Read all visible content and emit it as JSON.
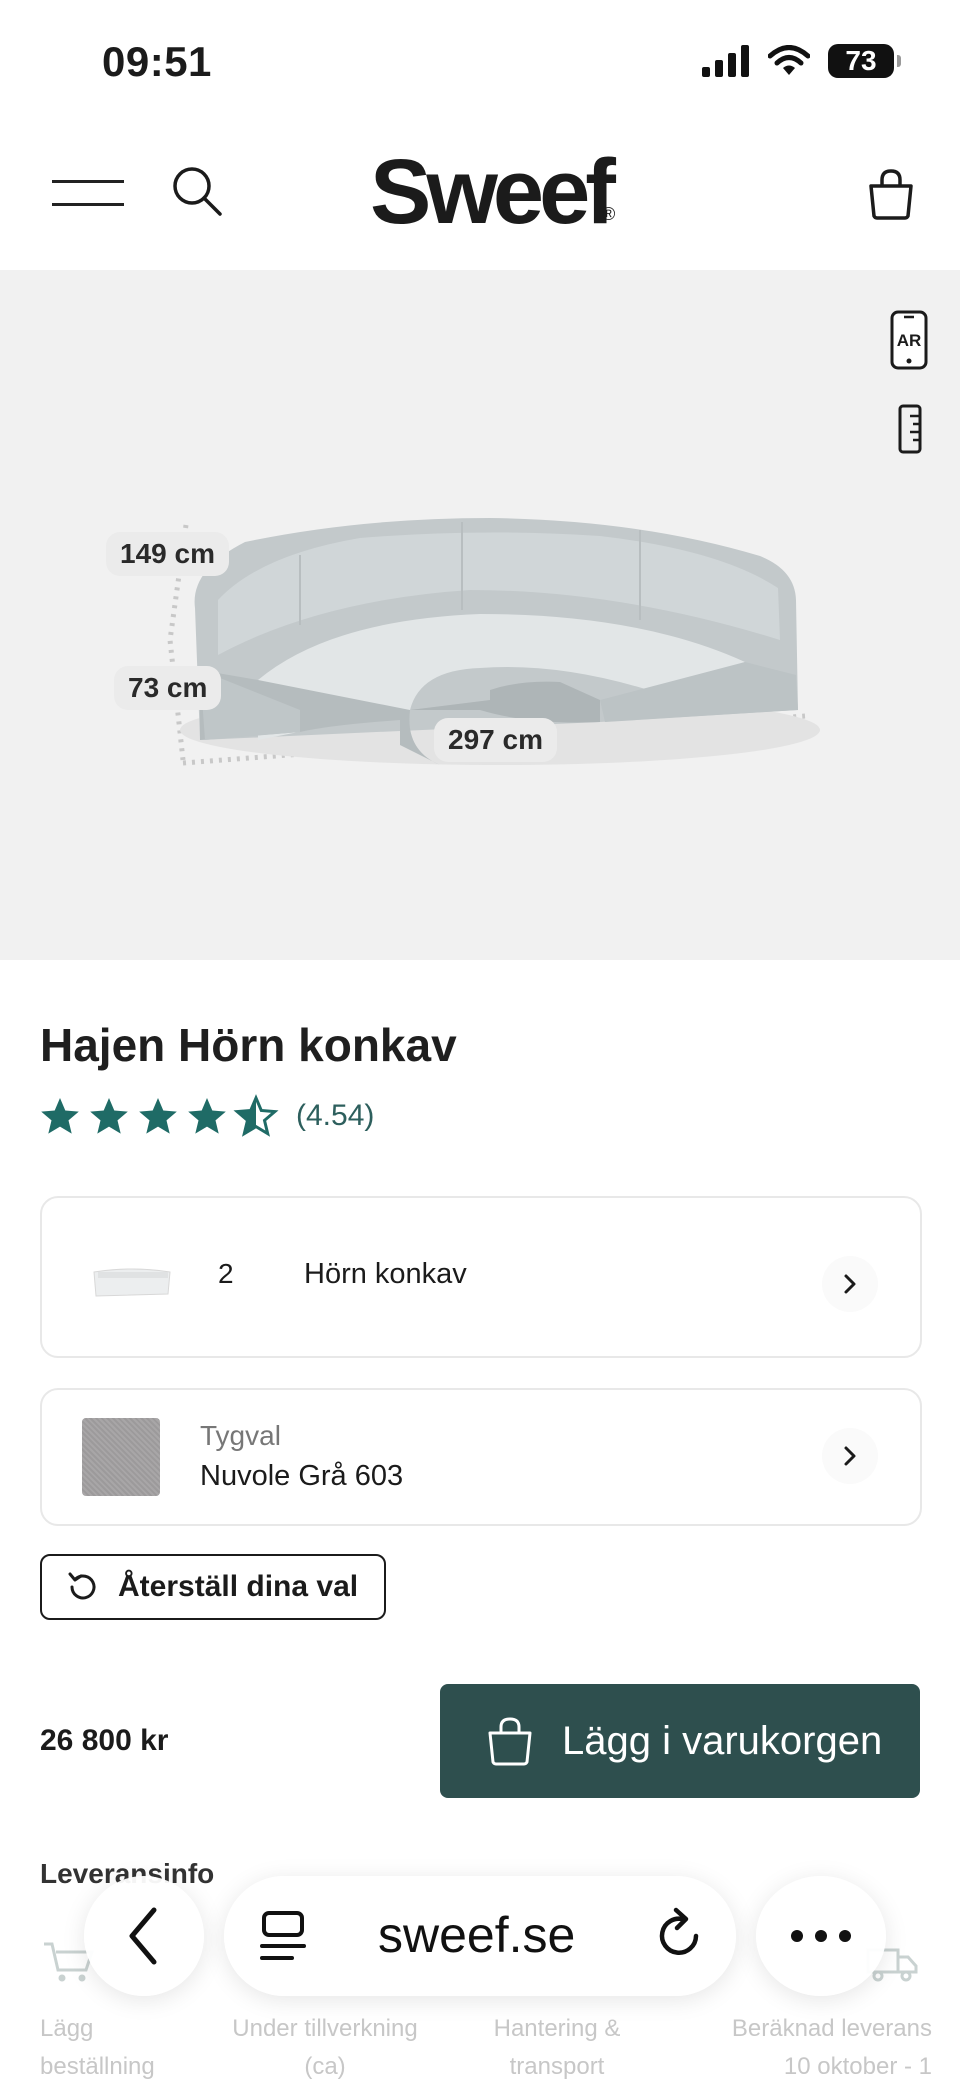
{
  "status_bar": {
    "time": "09:51",
    "battery": "73"
  },
  "header": {
    "logo": "Sweef",
    "logo_mark": "®"
  },
  "stage": {
    "ar_label": "AR",
    "dimensions": {
      "depth": "149 cm",
      "height": "73 cm",
      "width": "297 cm"
    }
  },
  "product": {
    "title": "Hajen Hörn konkav",
    "rating": {
      "stars": 4.5,
      "value_text": "(4.54)"
    },
    "module": {
      "quantity": "2",
      "name": "Hörn konkav"
    },
    "fabric": {
      "label": "Tygval",
      "value": "Nuvole Grå 603"
    },
    "reset_label": "Återställ dina val",
    "price": "26 800 kr",
    "add_to_cart_label": "Lägg i varukorgen"
  },
  "delivery": {
    "title": "Leveransinfo",
    "steps": [
      {
        "line1": "Lägg",
        "line2": "beställning"
      },
      {
        "line1": "Under tillverkning",
        "line2": "(ca)"
      },
      {
        "line1": "Hantering &",
        "line2": "transport"
      },
      {
        "line1": "Beräknad leverans",
        "line2": "10 oktober - 1"
      }
    ]
  },
  "browser": {
    "url": "sweef.se"
  },
  "colors": {
    "accent": "#2e4f4e",
    "star": "#1f6b66",
    "stage_bg": "#f1f1f1"
  }
}
